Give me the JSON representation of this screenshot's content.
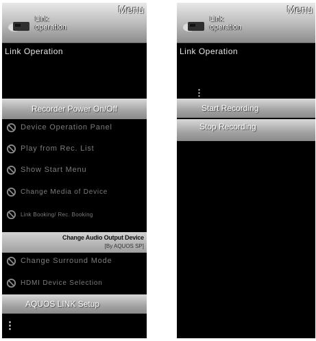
{
  "left": {
    "header": {
      "menu": "Menu",
      "link": "Link\noperation"
    },
    "title": "Link Operation",
    "recorder_power": "Recorder Power On/Off",
    "items": [
      "Device Operation Panel",
      "Play from Rec. List",
      "Show Start Menu",
      "Change Media of Device",
      "Link Booking/ Rec. Booking"
    ],
    "audio_output": {
      "main": "Change Audio Output Device",
      "sub": "[By AQUOS SP]"
    },
    "items2": [
      "Change Surround Mode",
      "HDMI Device Selection"
    ],
    "aquos_setup": "AQUOS LINK Setup",
    "more_indicator": "⋮"
  },
  "right": {
    "header": {
      "menu": "Menu",
      "link": "Link\noperation"
    },
    "title": "Link Operation",
    "more_indicator": "⋮",
    "start_recording": "Start Recording",
    "stop_recording": "Stop Recording"
  }
}
